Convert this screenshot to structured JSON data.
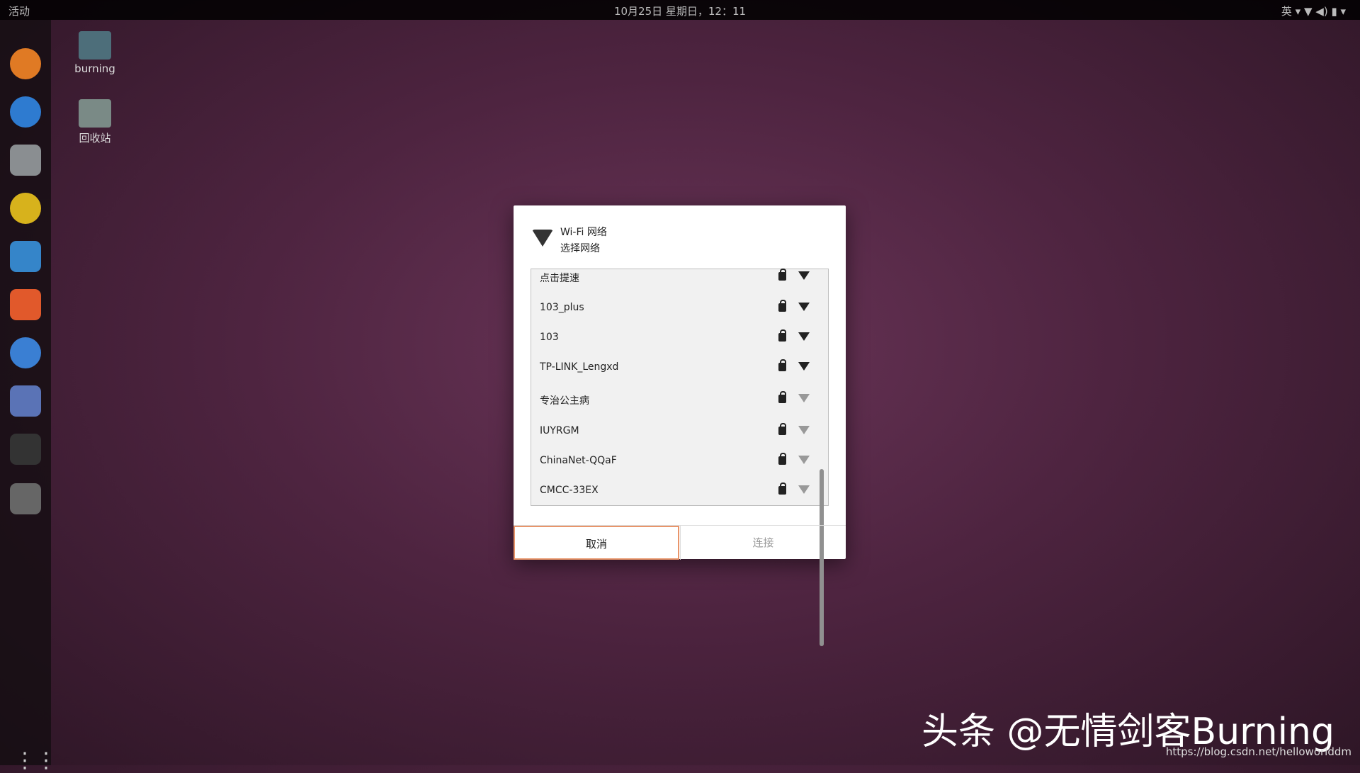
{
  "topbar": {
    "activities": "活动",
    "clock": "10月25日 星期日，12：11",
    "lang": "英 ▾",
    "tray": "▼ ◀) ▮ ▾"
  },
  "desktop": {
    "home_label": "burning",
    "trash_label": "回收站"
  },
  "dialog": {
    "title": "Wi-Fi 网络",
    "subtitle": "选择网络",
    "networks": [
      {
        "name": "点击提速",
        "strength": "strong"
      },
      {
        "name": "103_plus",
        "strength": "strong"
      },
      {
        "name": "103",
        "strength": "good"
      },
      {
        "name": "TP-LINK_Lengxd",
        "strength": "good"
      },
      {
        "name": "专治公主病",
        "strength": "weak"
      },
      {
        "name": "IUYRGM",
        "strength": "weak"
      },
      {
        "name": "ChinaNet-QQaF",
        "strength": "weak"
      },
      {
        "name": "CMCC-33EX",
        "strength": "weak"
      }
    ],
    "cancel": "取消",
    "connect": "连接"
  },
  "watermark": "头条 @无情剑客Burning",
  "url": "https://blog.csdn.net/helloworlddm"
}
